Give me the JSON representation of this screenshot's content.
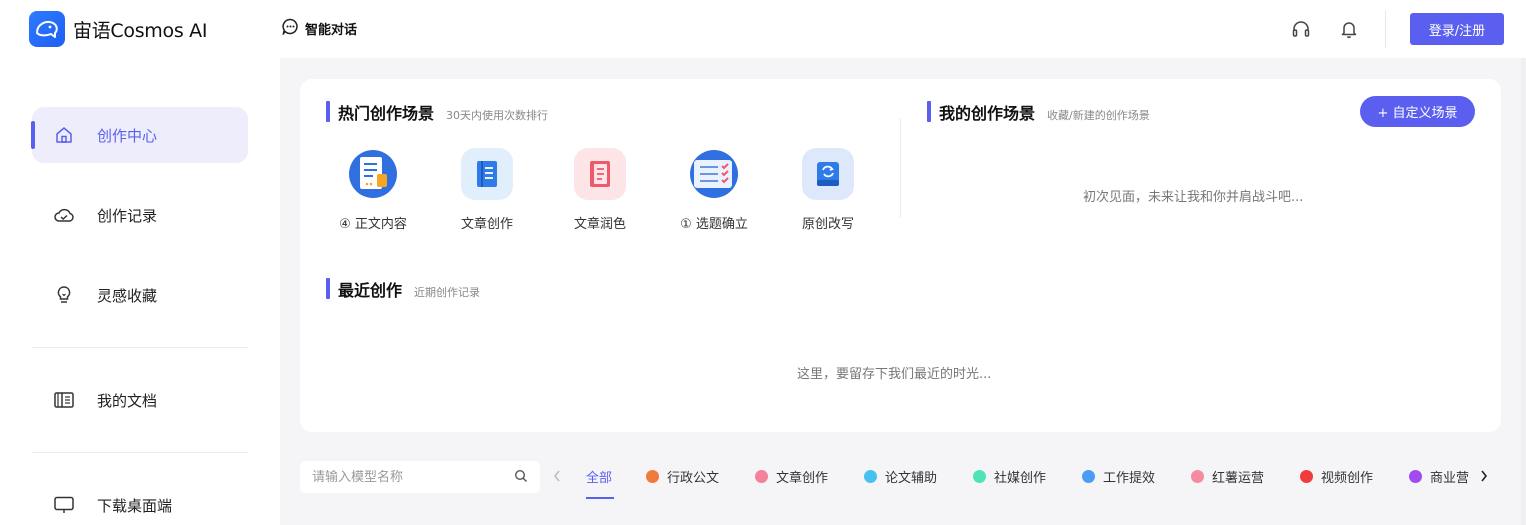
{
  "header": {
    "brand": "宙语Cosmos AI",
    "nav_chat": "智能对话",
    "login_label": "登录/注册"
  },
  "sidebar": {
    "items": [
      {
        "label": "创作中心",
        "icon": "home-icon",
        "active": true
      },
      {
        "label": "创作记录",
        "icon": "cloud-check-icon",
        "active": false
      },
      {
        "label": "灵感收藏",
        "icon": "lightbulb-icon",
        "active": false
      },
      {
        "label": "我的文档",
        "icon": "book-icon",
        "active": false
      },
      {
        "label": "下载桌面端",
        "icon": "monitor-icon",
        "active": false
      }
    ]
  },
  "hot_scenes": {
    "title": "热门创作场景",
    "subtitle": "30天内使用次数排行",
    "items": [
      {
        "label": "④ 正文内容",
        "icon": "document-list-icon"
      },
      {
        "label": "文章创作",
        "icon": "notebook-icon"
      },
      {
        "label": "文章润色",
        "icon": "book-red-icon"
      },
      {
        "label": "① 选题确立",
        "icon": "checklist-icon"
      },
      {
        "label": "原创改写",
        "icon": "refresh-book-icon"
      }
    ]
  },
  "my_scenes": {
    "title": "我的创作场景",
    "subtitle": "收藏/新建的创作场景",
    "custom_button": "+ 自定义场景",
    "empty_text": "初次见面，未来让我和你并肩战斗吧..."
  },
  "recent": {
    "title": "最近创作",
    "subtitle": "近期创作记录",
    "empty_text": "这里，要留存下我们最近的时光..."
  },
  "filter": {
    "search_placeholder": "请输入模型名称",
    "categories": [
      {
        "label": "全部",
        "color": "",
        "active": true
      },
      {
        "label": "行政公文",
        "color": "#f07a3c"
      },
      {
        "label": "文章创作",
        "color": "#f4829a"
      },
      {
        "label": "论文辅助",
        "color": "#47c1f0"
      },
      {
        "label": "社媒创作",
        "color": "#4fe3b8"
      },
      {
        "label": "工作提效",
        "color": "#4a9cf5"
      },
      {
        "label": "红薯运营",
        "color": "#f58aa0"
      },
      {
        "label": "视频创作",
        "color": "#f03c3c"
      },
      {
        "label": "商业营",
        "color": "#a24bf0"
      }
    ]
  },
  "colors": {
    "accent": "#5b5fef",
    "sidebar_active_bg": "#ededfc"
  }
}
